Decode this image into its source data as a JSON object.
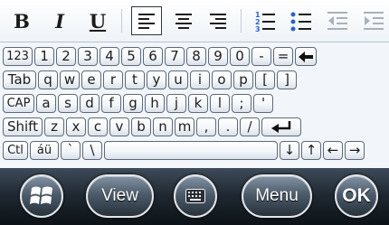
{
  "toolbar": {
    "bold_label": "B",
    "italic_label": "I",
    "underline_label": "U"
  },
  "keyboard": {
    "row1": [
      "123",
      "1",
      "2",
      "3",
      "4",
      "5",
      "6",
      "7",
      "8",
      "9",
      "0",
      "-",
      "="
    ],
    "row2": [
      "Tab",
      "q",
      "w",
      "e",
      "r",
      "t",
      "y",
      "u",
      "i",
      "o",
      "p",
      "[",
      "]"
    ],
    "row3": [
      "CAP",
      "a",
      "s",
      "d",
      "f",
      "g",
      "h",
      "j",
      "k",
      "l",
      ";",
      "'"
    ],
    "row4": [
      "Shift",
      "z",
      "x",
      "c",
      "v",
      "b",
      "n",
      "m",
      ",",
      ".",
      "/"
    ],
    "row5": [
      "Ctl",
      "áü",
      "`",
      "\\",
      "↓",
      "↑",
      "←",
      "→"
    ]
  },
  "bottom_bar": {
    "view_label": "View",
    "menu_label": "Menu",
    "ok_label": "OK"
  }
}
